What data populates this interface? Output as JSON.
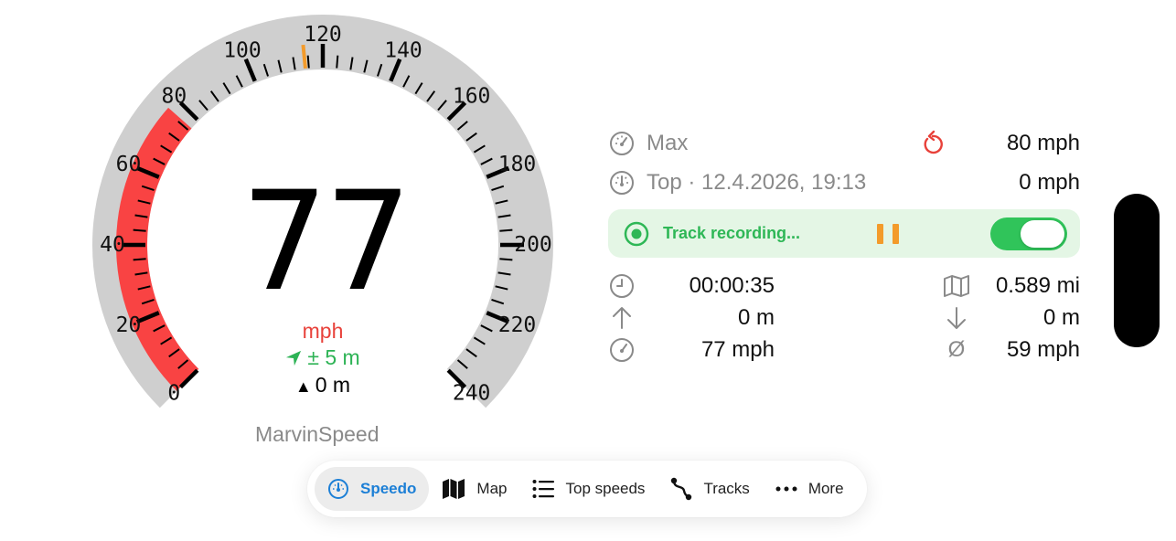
{
  "speedometer": {
    "speed": "77",
    "unit": "mph",
    "gps_accuracy": "± 5 m",
    "altitude": "0 m",
    "app_name": "MarvinSpeed",
    "scale_max": 240,
    "current_speed_value": 77,
    "marker_speed_value": 115,
    "tick_labels": [
      "0",
      "20",
      "40",
      "60",
      "80",
      "100",
      "120",
      "140",
      "160",
      "180",
      "200",
      "220",
      "240"
    ],
    "colors": {
      "gauge_band": "#cfcfcf",
      "speed_fill": "#f94343",
      "marker": "#f39b2b"
    }
  },
  "stats": {
    "max_label": "Max",
    "max_value": "80 mph",
    "top_label": "Top · 12.4.2026, 19:13",
    "top_value": "0 mph"
  },
  "track": {
    "label": "Track recording...",
    "paused": false,
    "enabled": true
  },
  "metrics": {
    "duration": "00:00:35",
    "distance": "0.589 mi",
    "ascent": "0 m",
    "descent": "0 m",
    "speed": "77 mph",
    "avg_symbol": "Ø",
    "avg_speed": "59 mph"
  },
  "icons": {
    "max": "gauge-icon",
    "top": "gauge-icon",
    "reset": "reset-icon",
    "record": "record-icon",
    "duration": "clock-icon",
    "distance": "map-icon",
    "ascent": "arrow-up-icon",
    "descent": "arrow-down-icon",
    "speed": "gauge-icon",
    "location": "location-arrow-icon"
  },
  "tabs": [
    {
      "label": "Speedo",
      "icon": "speedo-icon",
      "active": true
    },
    {
      "label": "Map",
      "icon": "map-icon",
      "active": false
    },
    {
      "label": "Top speeds",
      "icon": "list-icon",
      "active": false
    },
    {
      "label": "Tracks",
      "icon": "tracks-icon",
      "active": false
    },
    {
      "label": "More",
      "icon": "more-icon",
      "active": false
    }
  ]
}
